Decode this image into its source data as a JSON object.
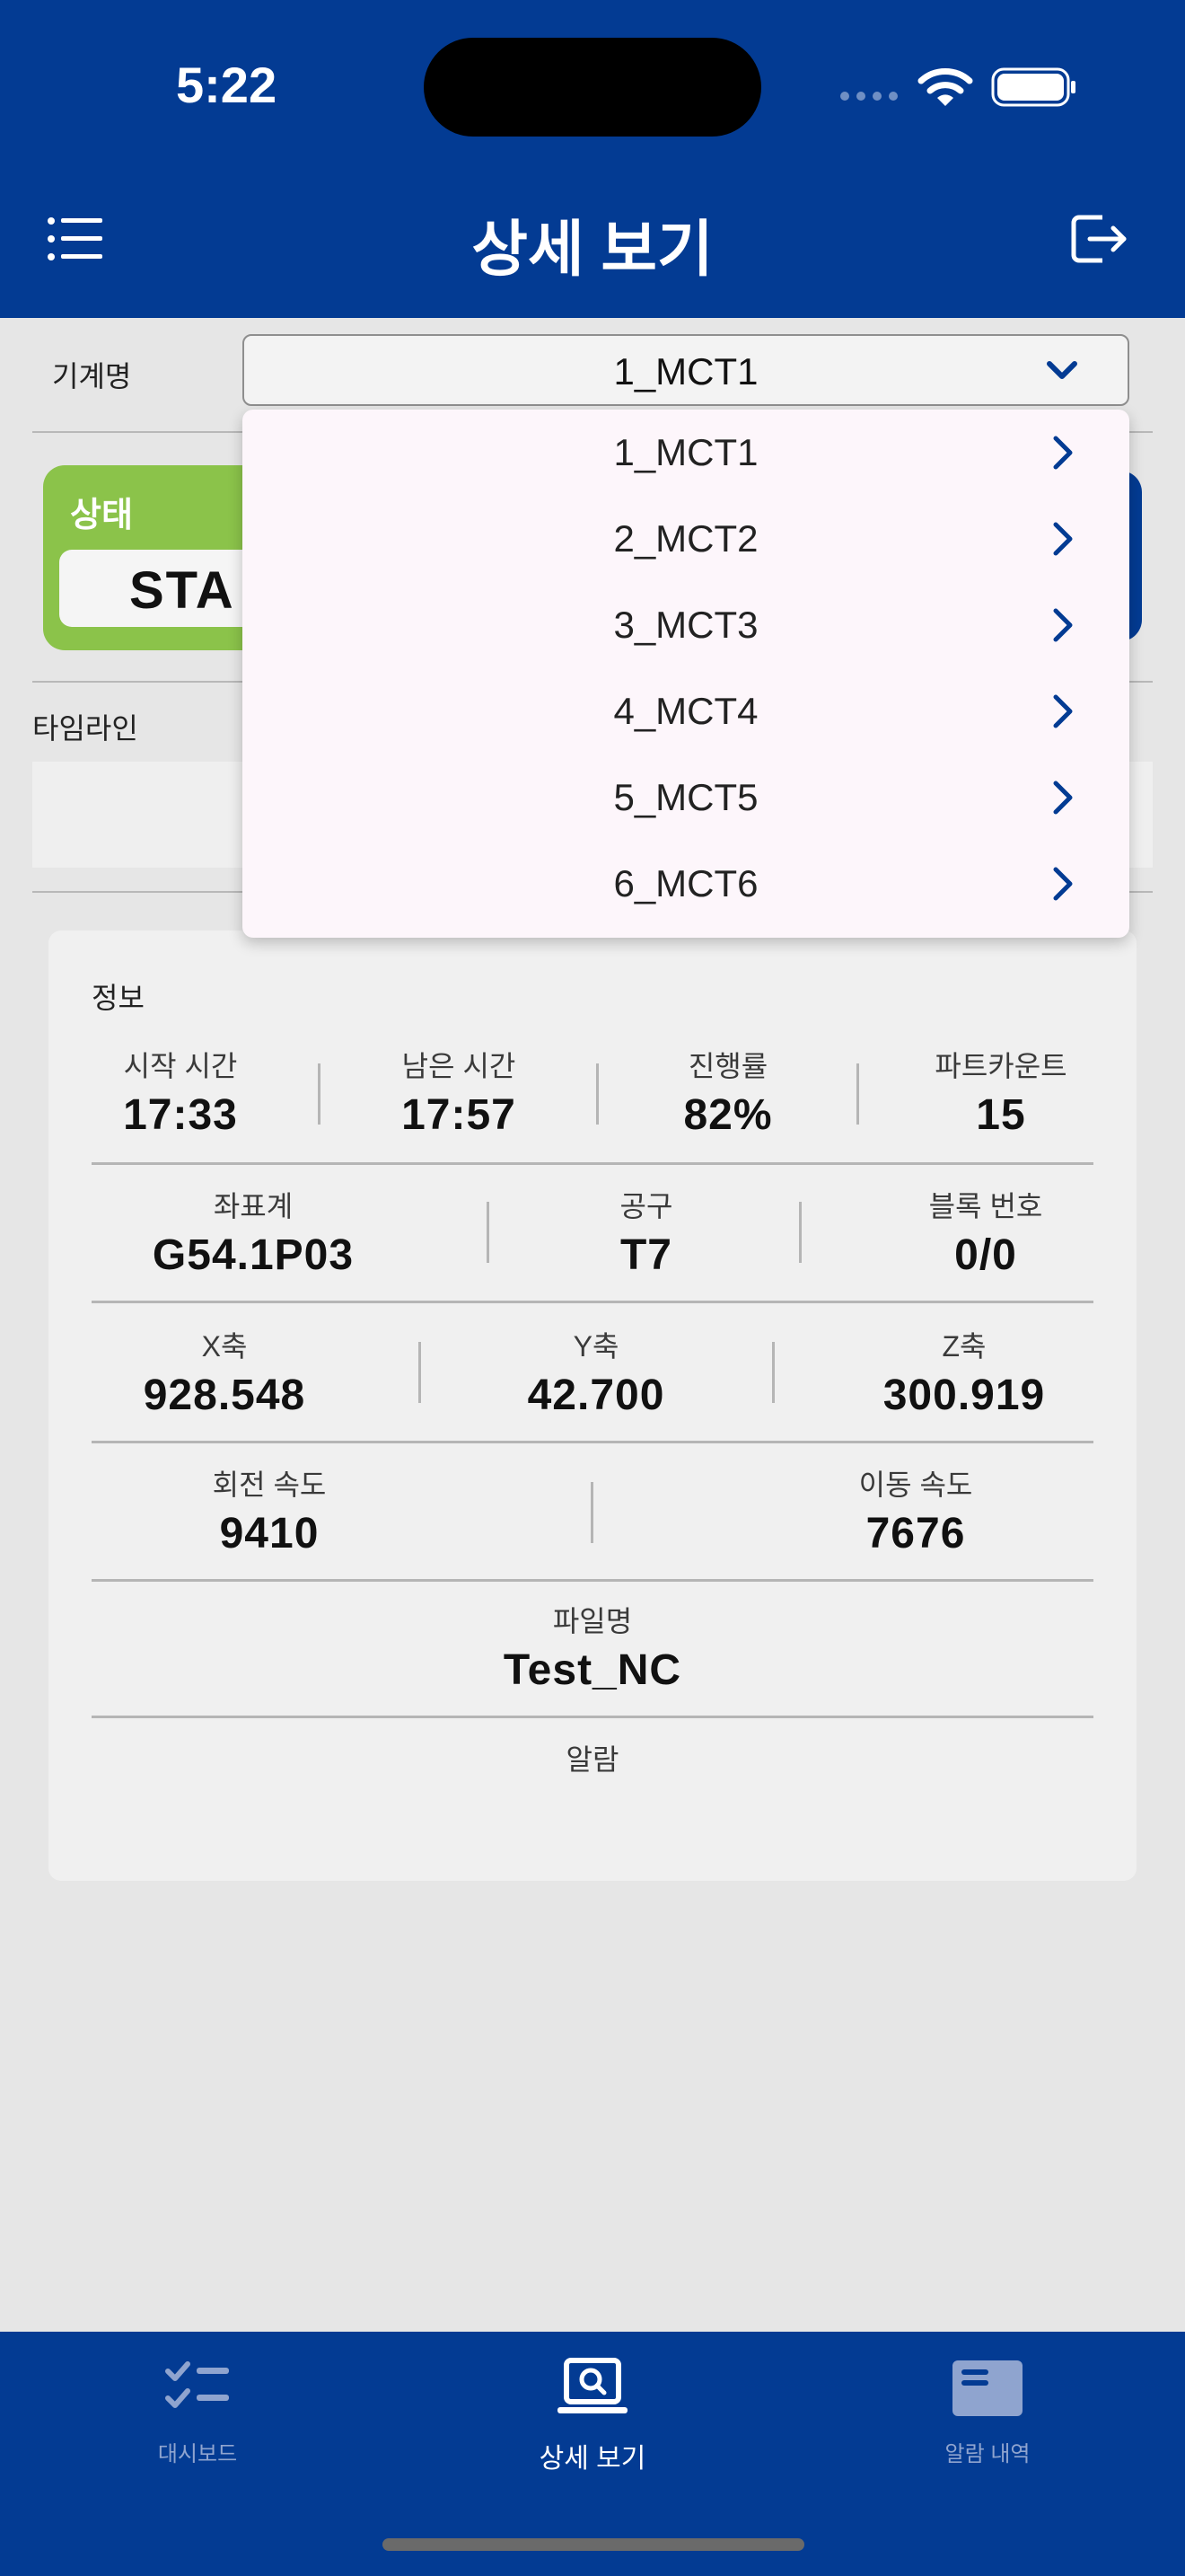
{
  "status_bar": {
    "time": "5:22"
  },
  "header": {
    "title": "상세 보기"
  },
  "machine": {
    "label": "기계명",
    "selected": "1_MCT1"
  },
  "dropdown": {
    "options": [
      "1_MCT1",
      "2_MCT2",
      "3_MCT3",
      "4_MCT4",
      "5_MCT5",
      "6_MCT6"
    ]
  },
  "status": {
    "label": "상태",
    "value": "STA"
  },
  "timeline": {
    "label": "타임라인"
  },
  "info": {
    "title": "정보",
    "start_time": {
      "label": "시작 시간",
      "value": "17:33"
    },
    "remaining_time": {
      "label": "남은 시간",
      "value": "17:57"
    },
    "progress": {
      "label": "진행률",
      "value": "82%"
    },
    "part_count": {
      "label": "파트카운트",
      "value": "15"
    },
    "coordinate": {
      "label": "좌표계",
      "value": "G54.1P03"
    },
    "tool": {
      "label": "공구",
      "value": "T7"
    },
    "block_number": {
      "label": "블록 번호",
      "value": "0/0"
    },
    "x_axis": {
      "label": "X축",
      "value": "928.548"
    },
    "y_axis": {
      "label": "Y축",
      "value": "42.700"
    },
    "z_axis": {
      "label": "Z축",
      "value": "300.919"
    },
    "spindle_speed": {
      "label": "회전 속도",
      "value": "9410"
    },
    "feed_speed": {
      "label": "이동 속도",
      "value": "7676"
    },
    "file_name": {
      "label": "파일명",
      "value": "Test_NC"
    },
    "alarm": {
      "label": "알람"
    }
  },
  "bottom_nav": {
    "dashboard": "대시보드",
    "detail": "상세 보기",
    "alarm_history": "알람 내역"
  },
  "colors": {
    "primary": "#033b93",
    "status_green": "#8bc34a"
  }
}
